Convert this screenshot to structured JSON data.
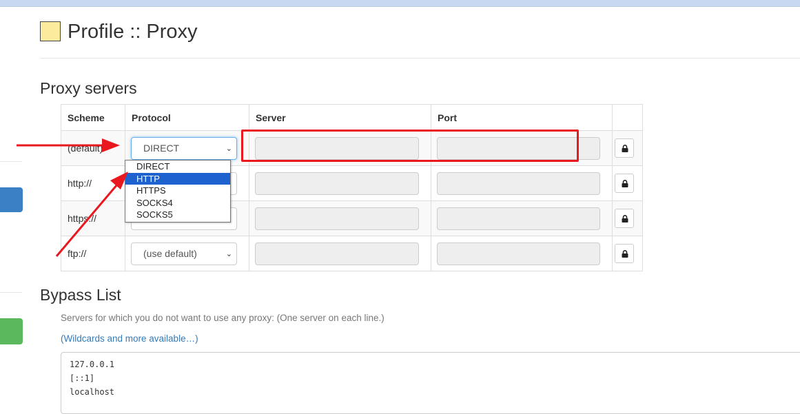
{
  "page": {
    "title": "Profile :: Proxy",
    "title_swatch_color": "#fdeb9d"
  },
  "proxy_servers": {
    "heading": "Proxy servers",
    "columns": [
      "Scheme",
      "Protocol",
      "Server",
      "Port",
      ""
    ],
    "rows": [
      {
        "scheme": "(default)",
        "protocol": "DIRECT",
        "server": "",
        "port": ""
      },
      {
        "scheme": "http://",
        "protocol": "",
        "server": "",
        "port": ""
      },
      {
        "scheme": "https://",
        "protocol": "",
        "server": "",
        "port": ""
      },
      {
        "scheme": "ftp://",
        "protocol": "(use default)",
        "server": "",
        "port": ""
      }
    ],
    "dropdown": {
      "open_row": 0,
      "options": [
        "DIRECT",
        "HTTP",
        "HTTPS",
        "SOCKS4",
        "SOCKS5"
      ],
      "highlighted": "HTTP"
    },
    "lock_icon": "lock-icon"
  },
  "bypass": {
    "heading": "Bypass List",
    "help": "Servers for which you do not want to use any proxy: (One server on each line.)",
    "link": "(Wildcards and more available…)",
    "lines": [
      "127.0.0.1",
      "[::1]",
      "localhost"
    ]
  },
  "annotations": {
    "color": "#e8181e"
  },
  "colors": {
    "accent_blue": "#3a80c4",
    "success_green": "#5cb85c",
    "highlight": "#1e62d0"
  }
}
